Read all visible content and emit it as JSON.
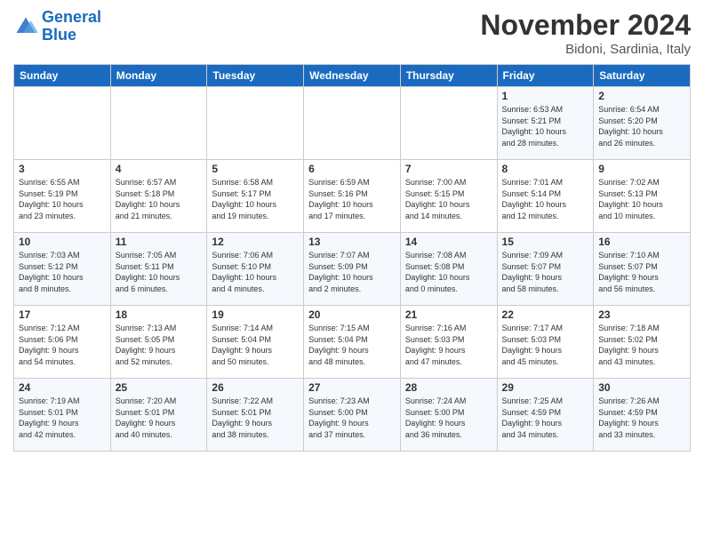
{
  "header": {
    "logo_line1": "General",
    "logo_line2": "Blue",
    "month_title": "November 2024",
    "location": "Bidoni, Sardinia, Italy"
  },
  "days_of_week": [
    "Sunday",
    "Monday",
    "Tuesday",
    "Wednesday",
    "Thursday",
    "Friday",
    "Saturday"
  ],
  "weeks": [
    [
      {
        "day": "",
        "info": ""
      },
      {
        "day": "",
        "info": ""
      },
      {
        "day": "",
        "info": ""
      },
      {
        "day": "",
        "info": ""
      },
      {
        "day": "",
        "info": ""
      },
      {
        "day": "1",
        "info": "Sunrise: 6:53 AM\nSunset: 5:21 PM\nDaylight: 10 hours\nand 28 minutes."
      },
      {
        "day": "2",
        "info": "Sunrise: 6:54 AM\nSunset: 5:20 PM\nDaylight: 10 hours\nand 26 minutes."
      }
    ],
    [
      {
        "day": "3",
        "info": "Sunrise: 6:55 AM\nSunset: 5:19 PM\nDaylight: 10 hours\nand 23 minutes."
      },
      {
        "day": "4",
        "info": "Sunrise: 6:57 AM\nSunset: 5:18 PM\nDaylight: 10 hours\nand 21 minutes."
      },
      {
        "day": "5",
        "info": "Sunrise: 6:58 AM\nSunset: 5:17 PM\nDaylight: 10 hours\nand 19 minutes."
      },
      {
        "day": "6",
        "info": "Sunrise: 6:59 AM\nSunset: 5:16 PM\nDaylight: 10 hours\nand 17 minutes."
      },
      {
        "day": "7",
        "info": "Sunrise: 7:00 AM\nSunset: 5:15 PM\nDaylight: 10 hours\nand 14 minutes."
      },
      {
        "day": "8",
        "info": "Sunrise: 7:01 AM\nSunset: 5:14 PM\nDaylight: 10 hours\nand 12 minutes."
      },
      {
        "day": "9",
        "info": "Sunrise: 7:02 AM\nSunset: 5:13 PM\nDaylight: 10 hours\nand 10 minutes."
      }
    ],
    [
      {
        "day": "10",
        "info": "Sunrise: 7:03 AM\nSunset: 5:12 PM\nDaylight: 10 hours\nand 8 minutes."
      },
      {
        "day": "11",
        "info": "Sunrise: 7:05 AM\nSunset: 5:11 PM\nDaylight: 10 hours\nand 6 minutes."
      },
      {
        "day": "12",
        "info": "Sunrise: 7:06 AM\nSunset: 5:10 PM\nDaylight: 10 hours\nand 4 minutes."
      },
      {
        "day": "13",
        "info": "Sunrise: 7:07 AM\nSunset: 5:09 PM\nDaylight: 10 hours\nand 2 minutes."
      },
      {
        "day": "14",
        "info": "Sunrise: 7:08 AM\nSunset: 5:08 PM\nDaylight: 10 hours\nand 0 minutes."
      },
      {
        "day": "15",
        "info": "Sunrise: 7:09 AM\nSunset: 5:07 PM\nDaylight: 9 hours\nand 58 minutes."
      },
      {
        "day": "16",
        "info": "Sunrise: 7:10 AM\nSunset: 5:07 PM\nDaylight: 9 hours\nand 56 minutes."
      }
    ],
    [
      {
        "day": "17",
        "info": "Sunrise: 7:12 AM\nSunset: 5:06 PM\nDaylight: 9 hours\nand 54 minutes."
      },
      {
        "day": "18",
        "info": "Sunrise: 7:13 AM\nSunset: 5:05 PM\nDaylight: 9 hours\nand 52 minutes."
      },
      {
        "day": "19",
        "info": "Sunrise: 7:14 AM\nSunset: 5:04 PM\nDaylight: 9 hours\nand 50 minutes."
      },
      {
        "day": "20",
        "info": "Sunrise: 7:15 AM\nSunset: 5:04 PM\nDaylight: 9 hours\nand 48 minutes."
      },
      {
        "day": "21",
        "info": "Sunrise: 7:16 AM\nSunset: 5:03 PM\nDaylight: 9 hours\nand 47 minutes."
      },
      {
        "day": "22",
        "info": "Sunrise: 7:17 AM\nSunset: 5:03 PM\nDaylight: 9 hours\nand 45 minutes."
      },
      {
        "day": "23",
        "info": "Sunrise: 7:18 AM\nSunset: 5:02 PM\nDaylight: 9 hours\nand 43 minutes."
      }
    ],
    [
      {
        "day": "24",
        "info": "Sunrise: 7:19 AM\nSunset: 5:01 PM\nDaylight: 9 hours\nand 42 minutes."
      },
      {
        "day": "25",
        "info": "Sunrise: 7:20 AM\nSunset: 5:01 PM\nDaylight: 9 hours\nand 40 minutes."
      },
      {
        "day": "26",
        "info": "Sunrise: 7:22 AM\nSunset: 5:01 PM\nDaylight: 9 hours\nand 38 minutes."
      },
      {
        "day": "27",
        "info": "Sunrise: 7:23 AM\nSunset: 5:00 PM\nDaylight: 9 hours\nand 37 minutes."
      },
      {
        "day": "28",
        "info": "Sunrise: 7:24 AM\nSunset: 5:00 PM\nDaylight: 9 hours\nand 36 minutes."
      },
      {
        "day": "29",
        "info": "Sunrise: 7:25 AM\nSunset: 4:59 PM\nDaylight: 9 hours\nand 34 minutes."
      },
      {
        "day": "30",
        "info": "Sunrise: 7:26 AM\nSunset: 4:59 PM\nDaylight: 9 hours\nand 33 minutes."
      }
    ]
  ]
}
